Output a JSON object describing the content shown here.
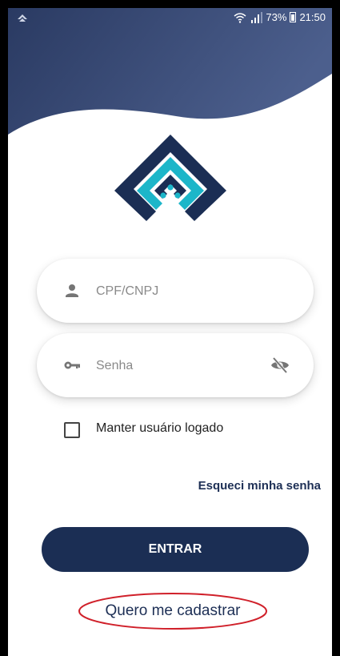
{
  "status_bar": {
    "left_icon": "notification-icon",
    "battery_percent": "73%",
    "time": "21:50",
    "icons": [
      "wifi-icon",
      "signal-icon",
      "battery-icon"
    ]
  },
  "colors": {
    "brand_navy": "#1b2e54",
    "header_gradient_start": "#2c3d66",
    "header_gradient_end": "#4a5e8c",
    "logo_cyan": "#1cb6c9",
    "annotation_red": "#d0202a"
  },
  "login": {
    "cpf_placeholder": "CPF/CNPJ",
    "password_placeholder": "Senha",
    "remember_label": "Manter usuário logado",
    "remember_checked": false,
    "forgot_password": "Esqueci minha senha",
    "submit_label": "ENTRAR",
    "register_label": "Quero me cadastrar"
  }
}
